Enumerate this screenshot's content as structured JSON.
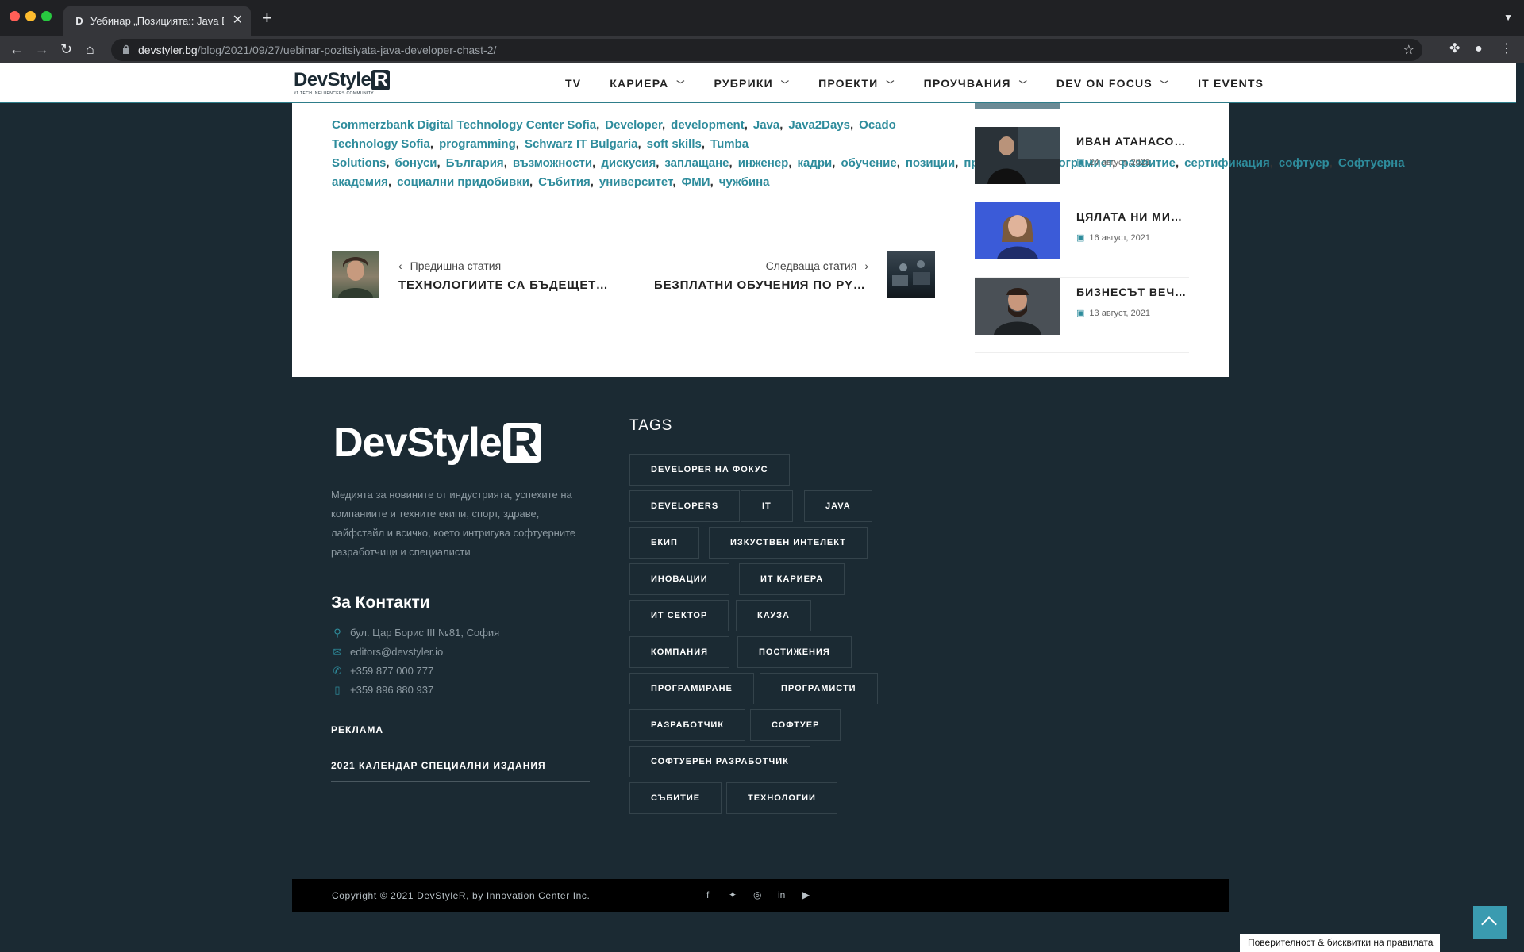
{
  "browser": {
    "tab_title": "Уебинар „Позицията:: Java Dev",
    "tab_favicon": "D",
    "url_domain": "devstyler.bg",
    "url_path": "/blog/2021/09/27/uebinar-pozitsiyata-java-developer-chast-2/"
  },
  "header": {
    "logo_text": "DevStyle",
    "logo_r": "R",
    "logo_sub": "#1 TECH INFLUENCERS COMMUNITY",
    "nav": [
      {
        "label": "TV",
        "has_dropdown": false
      },
      {
        "label": "КАРИЕРА",
        "has_dropdown": true
      },
      {
        "label": "РУБРИКИ",
        "has_dropdown": true
      },
      {
        "label": "ПРОЕКТИ",
        "has_dropdown": true
      },
      {
        "label": "ПРОУЧВАНИЯ",
        "has_dropdown": true
      },
      {
        "label": "DEV ON FOCUS",
        "has_dropdown": true
      },
      {
        "label": "IT EVENTS",
        "has_dropdown": false
      }
    ]
  },
  "article": {
    "tags": [
      "Commerzbank Digital Technology Center Sofia",
      "Developer",
      "development",
      "Java",
      "Java2Days",
      "Ocado Technology Sofia",
      "programming",
      "Schwarz IT Bulgaria",
      "soft skills",
      "Tumba Solutions",
      "бонуси",
      "България",
      "възможности",
      "дискусия",
      "заплащане",
      "инженер",
      "кадри",
      "обучение",
      "позиции",
      "привличане",
      "програмист",
      "развитие",
      "сертификация",
      "софтуер",
      "Софтуерна академия",
      "социални придобивки",
      "Събития",
      "университет",
      "ФМИ",
      "чужбина"
    ],
    "prev": {
      "label": "Предишна статия",
      "title": "ТЕХНОЛОГИИТЕ СА БЪДЕЩЕТО. П..."
    },
    "next": {
      "label": "Следваща статия",
      "title": "БЕЗПЛАТНИ ОБУЧЕНИЯ ПО PYTHO..."
    }
  },
  "sidebar": {
    "items": [
      {
        "title": "ИВАН АТАНАСОВ П...",
        "date": "24 август, 2021"
      },
      {
        "title": "ЦЯЛАТА НИ МИСИЯ...",
        "date": "16 август, 2021"
      },
      {
        "title": "БИЗНЕСЪТ ВЕЧЕ С...",
        "date": "13 август, 2021"
      }
    ]
  },
  "footer": {
    "logo_text": "DevStyle",
    "logo_r": "R",
    "description": "Медията за новините от индустрията, успехите на компаниите и техните екипи, спорт, здраве, лайфстайл и всичко, което интригува софтуерните разработчици и специалисти",
    "contact_heading": "За Контакти",
    "address": "бул. Цар Борис III №81, София",
    "email": "editors@devstyler.io",
    "phone1": "+359 877 000 777",
    "phone2": "+359 896 880 937",
    "links": [
      "РЕКЛАМА",
      "2021 КАЛЕНДАР СПЕЦИАЛНИ ИЗДАНИЯ"
    ],
    "tags_heading": "TAGS",
    "tags": [
      "DEVELOPER НА ФОКУС",
      "DEVELOPERS",
      "IT",
      "JAVA",
      "ЕКИП",
      "ИЗКУСТВЕН ИНТЕЛЕКТ",
      "ИНОВАЦИИ",
      "ИТ КАРИЕРА",
      "ИТ СЕКТОР",
      "КАУЗА",
      "КОМПАНИЯ",
      "ПОСТИЖЕНИЯ",
      "ПРОГРАМИРАНЕ",
      "ПРОГРАМИСТИ",
      "РАЗРАБОТЧИК",
      "СОФТУЕР",
      "СОФТУЕРЕН РАЗРАБОТЧИК",
      "СЪБИТИЕ",
      "ТЕХНОЛОГИИ"
    ],
    "copyright": "Copyright © 2021 DevStyleR, by Innovation Center Inc.",
    "social_icons": [
      "facebook-icon",
      "twitter-icon",
      "instagram-icon",
      "linkedin-icon",
      "youtube-icon"
    ]
  },
  "privacy_label": "Поверителност & бисквитки на правилата",
  "colors": {
    "accent": "#2e8c9c",
    "background": "#1b2a33",
    "tag_border": "#34434b"
  }
}
